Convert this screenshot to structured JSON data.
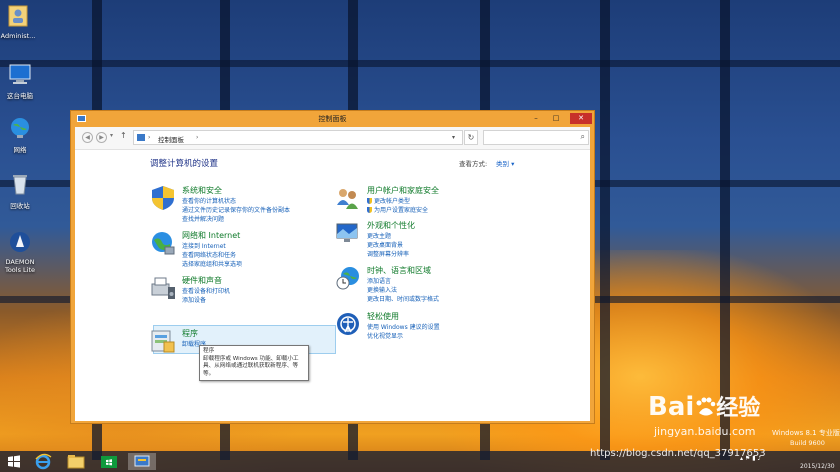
{
  "desktop": {
    "icons": [
      {
        "label": "Administ...",
        "icon": "user-folder-icon"
      },
      {
        "label": "这台电脑",
        "icon": "computer-icon"
      },
      {
        "label": "网络",
        "icon": "network-icon"
      },
      {
        "label": "回收站",
        "icon": "recycle-bin-icon"
      },
      {
        "label": "DAEMON Tools Lite",
        "icon": "daemon-tools-icon"
      }
    ],
    "watermarks": {
      "os_name": "Windows 8.1 专业版",
      "build": "Build 9600",
      "date": "2015/12/30",
      "site": "jingyan.baidu.com",
      "blog": "https://blog.csdn.net/qq_37917653",
      "brand_left": "Bai",
      "brand_paw": "du",
      "brand_right": "经验"
    }
  },
  "window": {
    "title": "控制面板",
    "minimize": "–",
    "maximize": "□",
    "close": "✕",
    "breadcrumb": "控制面板",
    "search_placeholder": "",
    "heading": "调整计算机的设置",
    "view_by_label": "查看方式:",
    "view_by_value": "类别 ▾",
    "left_categories": [
      {
        "title": "系统和安全",
        "icon": "shield-computer-icon",
        "links": [
          "查看你的计算机状态",
          "通过文件历史记录保存你的文件备份副本",
          "查找并解决问题"
        ]
      },
      {
        "title": "网络和 Internet",
        "icon": "globe-network-icon",
        "links": [
          "连接到 Internet",
          "查看网络状态和任务",
          "选择家庭组和共享选项"
        ]
      },
      {
        "title": "硬件和声音",
        "icon": "printer-speaker-icon",
        "links": [
          "查看设备和打印机",
          "添加设备"
        ]
      },
      {
        "title": "程序",
        "icon": "programs-icon",
        "links": [
          "卸载程序"
        ]
      }
    ],
    "right_categories": [
      {
        "title": "用户帐户和家庭安全",
        "icon": "users-icon",
        "links": [
          "更改帐户类型",
          "为用户设置家庭安全"
        ]
      },
      {
        "title": "外观和个性化",
        "icon": "monitor-paint-icon",
        "links": [
          "更改主题",
          "更改桌面背景",
          "调整屏幕分辨率"
        ]
      },
      {
        "title": "时钟、语言和区域",
        "icon": "clock-globe-icon",
        "links": [
          "添加语言",
          "更换输入法",
          "更改日期、时间或数字格式"
        ]
      },
      {
        "title": "轻松使用",
        "icon": "ease-of-access-icon",
        "links": [
          "使用 Windows 建议的设置",
          "优化视觉显示"
        ]
      }
    ],
    "tooltip": {
      "title": "程序",
      "body": "卸载程序或 Windows 功能、卸载小工具、从网络或通过联机获取新程序、等等。"
    }
  },
  "taskbar": {
    "items": [
      {
        "icon": "windows-start-icon"
      },
      {
        "icon": "internet-explorer-icon"
      },
      {
        "icon": "file-explorer-icon"
      },
      {
        "icon": "windows-store-icon"
      },
      {
        "icon": "control-panel-icon"
      }
    ]
  }
}
